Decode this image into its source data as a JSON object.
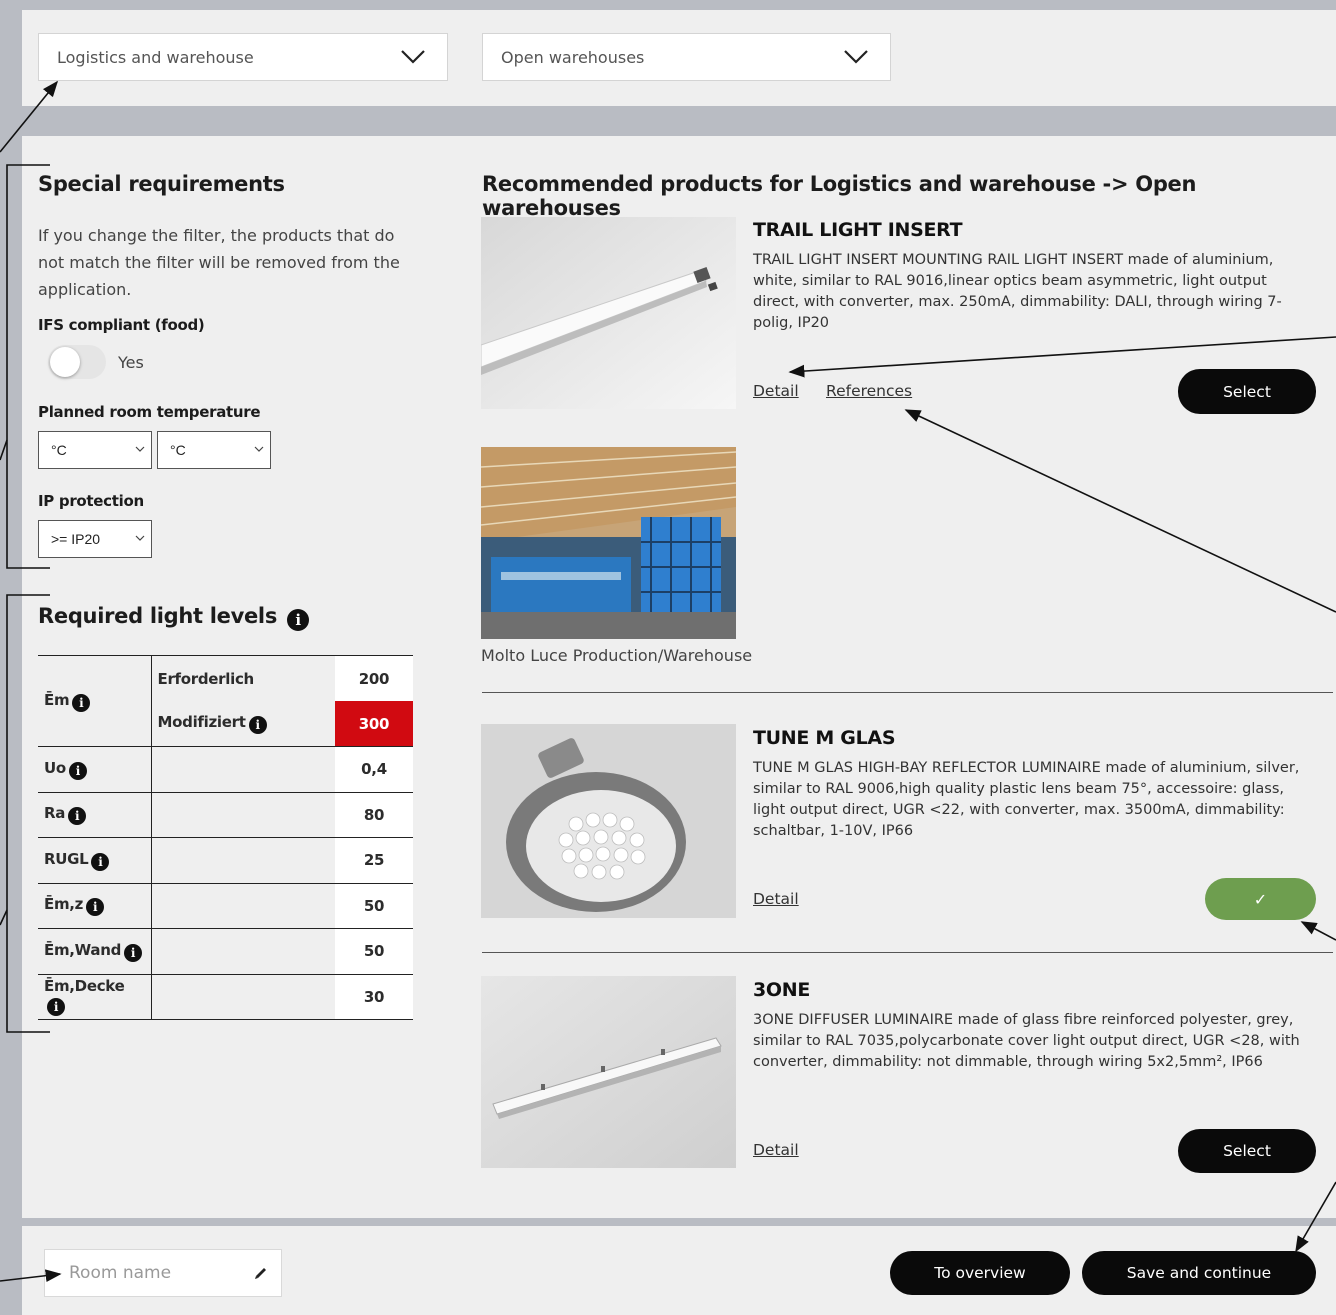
{
  "filters": {
    "sector": "Logistics and warehouse",
    "application": "Open warehouses"
  },
  "special": {
    "title": "Special requirements",
    "note": "If you change the filter, the products that do not match the filter will be removed from the application.",
    "ifs_label": "IFS compliant (food)",
    "ifs_option": "Yes",
    "ifs_enabled": false,
    "temp_label": "Planned room temperature",
    "temp_min": "°C",
    "temp_max": "°C",
    "ip_label": "IP protection",
    "ip_value": ">= IP20"
  },
  "levels": {
    "title": "Required light levels",
    "rows": [
      {
        "name": "Ēm",
        "sub1": "Erforderlich",
        "val1": "200",
        "sub2": "Modifiziert",
        "val2": "300"
      },
      {
        "name": "Uo",
        "val": "0,4"
      },
      {
        "name": "Ra",
        "val": "80"
      },
      {
        "name": "RUGL",
        "val": "25"
      },
      {
        "name": "Ēm,z",
        "val": "50"
      },
      {
        "name": "Ēm,Wand",
        "val": "50"
      },
      {
        "name": "Ēm,Decke",
        "val": "30"
      }
    ]
  },
  "products": {
    "title": "Recommended products for Logistics and warehouse -> Open warehouses",
    "items": [
      {
        "name": "TRAIL LIGHT INSERT",
        "desc": "TRAIL LIGHT INSERT MOUNTING RAIL LIGHT INSERT made of aluminium, white, similar to RAL 9016,linear optics beam asymmetric, light output direct, with converter, max. 250mA, dimmability: DALI, through wiring 7-polig, IP20",
        "detail": "Detail",
        "references": "References",
        "action": "Select",
        "reference_caption": "Molto Luce Production/Warehouse"
      },
      {
        "name": "TUNE M GLAS",
        "desc": "TUNE M GLAS HIGH-BAY REFLECTOR LUMINAIRE made of aluminium, silver, similar to RAL 9006,high quality plastic lens beam 75°, accessoire: glass, light output direct, UGR <22, with converter, max. 3500mA, dimmability: schaltbar, 1-10V, IP66",
        "detail": "Detail",
        "action": "✓",
        "selected": true
      },
      {
        "name": "3ONE",
        "desc": "3ONE DIFFUSER LUMINAIRE made of glass fibre reinforced polyester, grey, similar to RAL 7035,polycarbonate cover light output direct, UGR <28, with converter, dimmability: not dimmable, through wiring 5x2,5mm², IP66",
        "detail": "Detail",
        "action": "Select"
      }
    ]
  },
  "footer": {
    "room_placeholder": "Room name",
    "to_overview": "To overview",
    "save_continue": "Save and continue"
  },
  "colors": {
    "accent_red": "#d10a11",
    "selected_green": "#6e9e4f",
    "button_black": "#0a0a0a"
  }
}
